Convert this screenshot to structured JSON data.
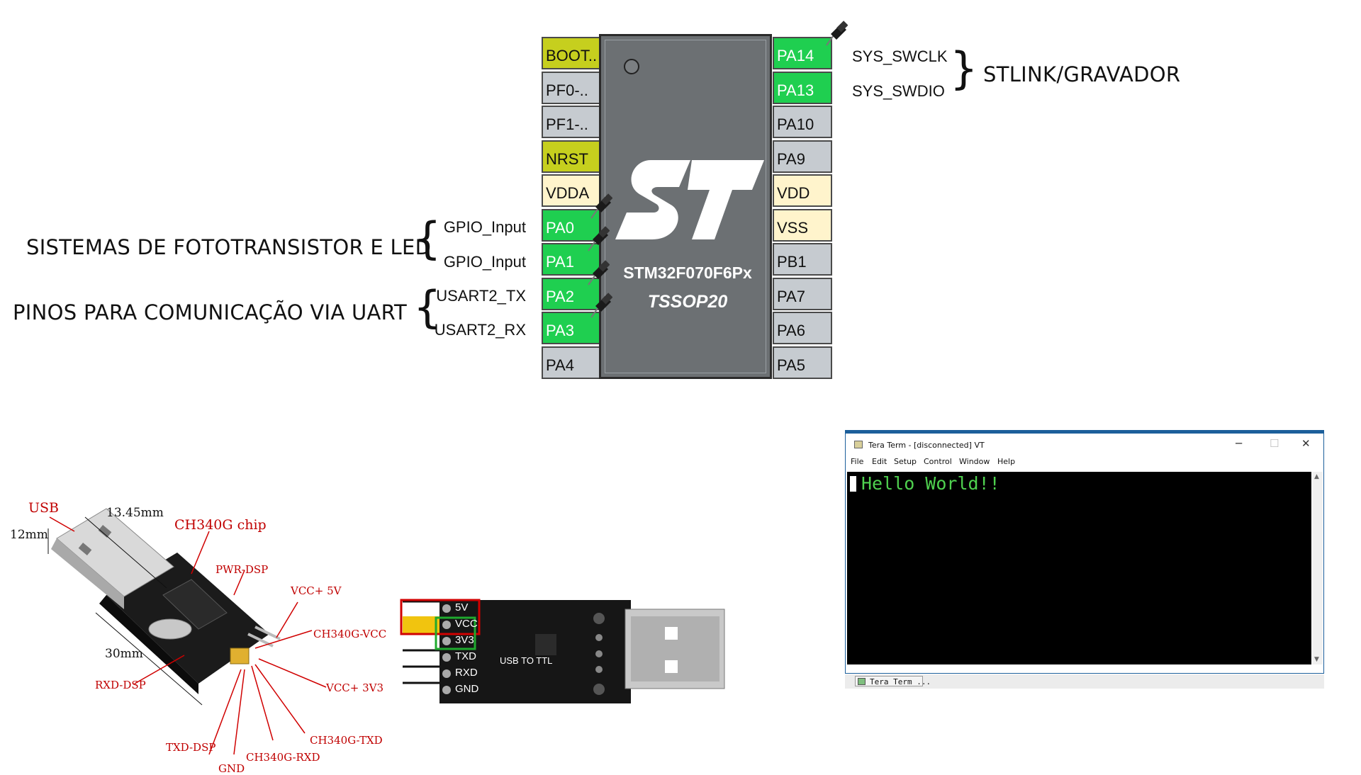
{
  "chip": {
    "name": "STM32F070F6Px",
    "package": "TSSOP20",
    "left_pins": [
      {
        "label": "BOOT..",
        "style": "olive"
      },
      {
        "label": "PF0-..",
        "style": "gray"
      },
      {
        "label": "PF1-..",
        "style": "gray"
      },
      {
        "label": "NRST",
        "style": "olive"
      },
      {
        "label": "VDDA",
        "style": "cream"
      },
      {
        "label": "PA0",
        "style": "green"
      },
      {
        "label": "PA1",
        "style": "green"
      },
      {
        "label": "PA2",
        "style": "green"
      },
      {
        "label": "PA3",
        "style": "green"
      },
      {
        "label": "PA4",
        "style": "gray"
      }
    ],
    "right_pins": [
      {
        "label": "PA14",
        "style": "green"
      },
      {
        "label": "PA13",
        "style": "green"
      },
      {
        "label": "PA10",
        "style": "gray"
      },
      {
        "label": "PA9",
        "style": "gray"
      },
      {
        "label": "VDD",
        "style": "cream"
      },
      {
        "label": "VSS",
        "style": "cream"
      },
      {
        "label": "PB1",
        "style": "gray"
      },
      {
        "label": "PA7",
        "style": "gray"
      },
      {
        "label": "PA6",
        "style": "gray"
      },
      {
        "label": "PA5",
        "style": "gray"
      }
    ],
    "left_signals": [
      "GPIO_Input",
      "GPIO_Input",
      "USART2_TX",
      "USART2_RX"
    ],
    "right_signals": [
      "SYS_SWCLK",
      "SYS_SWDIO"
    ],
    "colors": {
      "olive": "#c6cf1e",
      "green": "#1fcf50",
      "cream": "#fff4cc",
      "gray": "#c6cbd0",
      "body": "#6c7073"
    }
  },
  "groups": {
    "stlink": "STLINK/GRAVADOR",
    "phototransistor": "SISTEMAS DE FOTOTRANSISTOR E LED",
    "uart": "PINOS PARA COMUNICAÇÃO VIA UART"
  },
  "usb_module": {
    "labels": {
      "usb": "USB",
      "chip": "CH340G chip",
      "pwr_dsp": "PWR-DSP",
      "vcc5": "VCC+ 5V",
      "ch340_vcc": "CH340G-VCC",
      "vcc33": "VCC+ 3V3",
      "ch340_txd": "CH340G-TXD",
      "ch340_rxd": "CH340G-RXD",
      "gnd": "GND",
      "txd_dsp": "TXD-DSP",
      "rxd_dsp": "RXD-DSP"
    },
    "dimensions": {
      "length": "30mm",
      "height": "12mm",
      "width": "13.45mm"
    },
    "board_text": "USB TO TTL",
    "pins": [
      "5V",
      "VCC",
      "3V3",
      "TXD",
      "RXD",
      "GND"
    ]
  },
  "teraterm": {
    "title": "Tera Term - [disconnected] VT",
    "menu": [
      "File",
      "Edit",
      "Setup",
      "Control",
      "Window",
      "Help"
    ],
    "output": "Hello World!!",
    "taskbar_item": "Tera Term ...",
    "controls": {
      "minimize": "─",
      "maximize": "☐",
      "close": "✕"
    },
    "colors": {
      "terminal_bg": "#000000",
      "terminal_text": "#4fd14f",
      "accent": "#1c5f9b"
    }
  }
}
